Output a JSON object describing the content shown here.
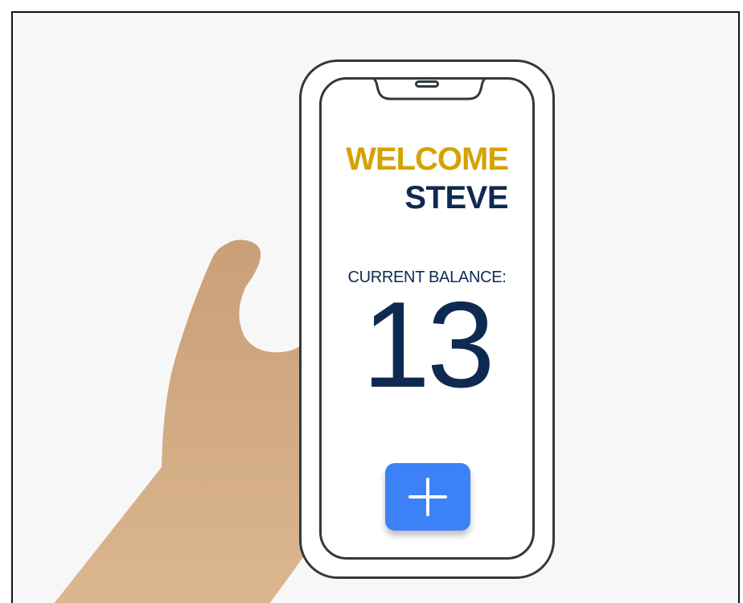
{
  "colors": {
    "page_background": "#f7f7f8",
    "hand": "#d8b189",
    "phone_outline": "#2e3a40",
    "welcome_accent": "#d4a300",
    "text_primary": "#0f2a52",
    "button": "#3c82f6"
  },
  "screen": {
    "welcome_label": "WELCOME",
    "user_name": "STEVE",
    "balance_label": "CURRENT BALANCE:",
    "balance_value": "13"
  },
  "actions": {
    "add_button_icon": "plus-icon"
  }
}
